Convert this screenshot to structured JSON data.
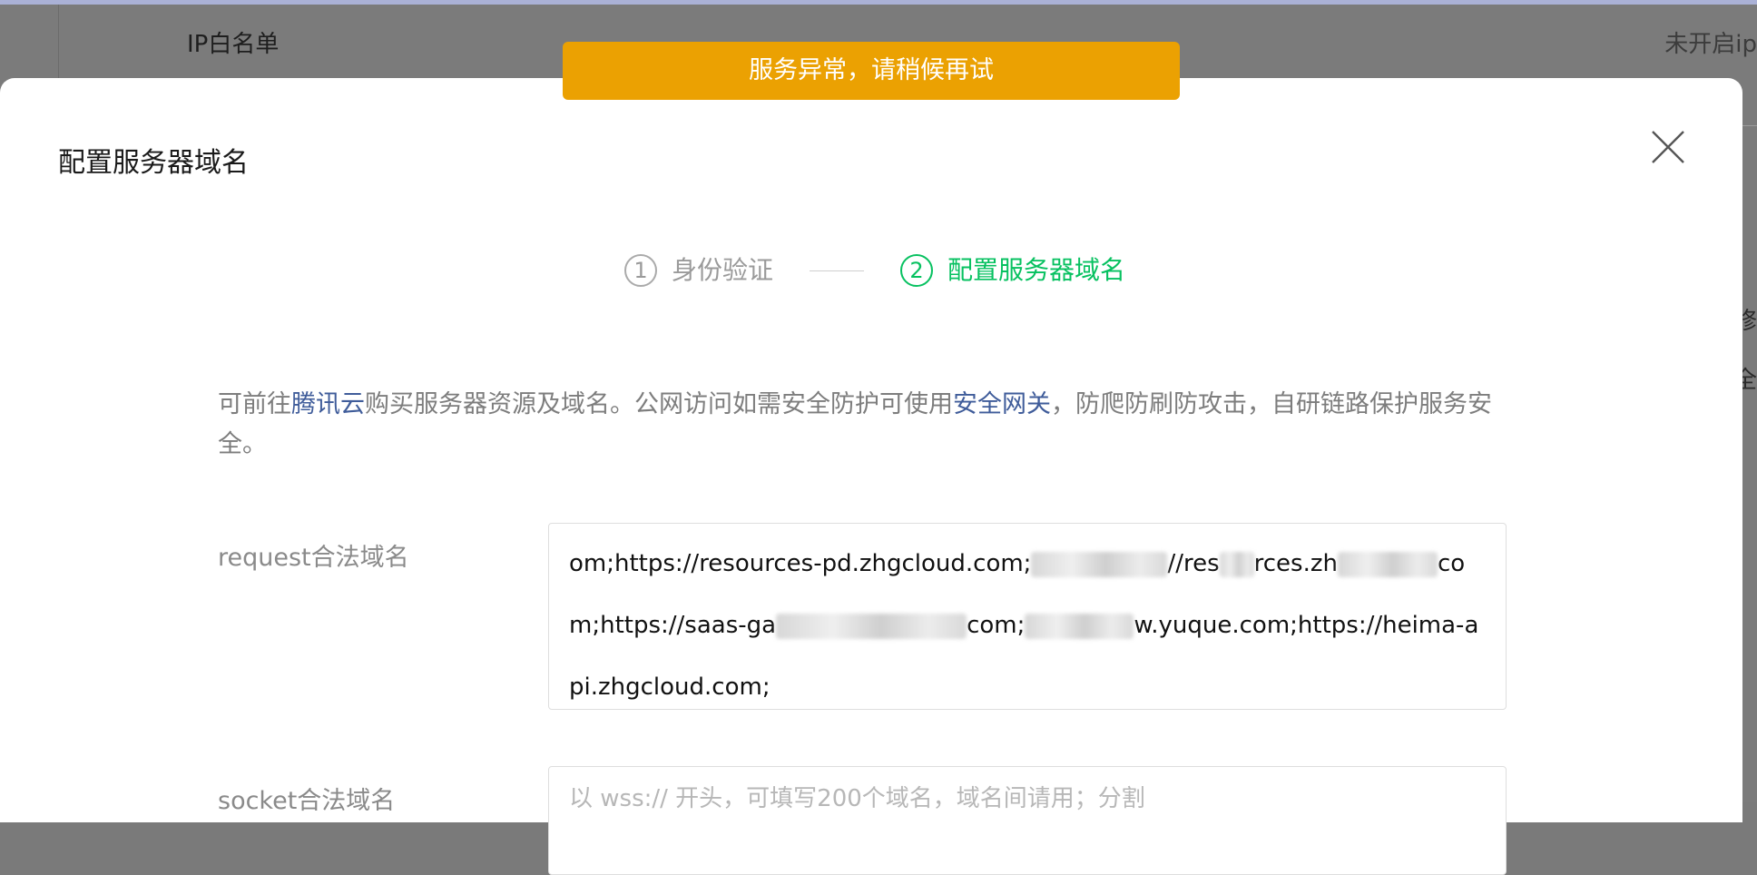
{
  "background": {
    "title": "IP白名单",
    "right_text": "未开启ip",
    "side_char_1": "修",
    "side_char_2": "全"
  },
  "toast": {
    "message": "服务异常，请稍候再试",
    "color": "#eba102"
  },
  "dialog": {
    "title": "配置服务器域名",
    "close_icon": "close-icon"
  },
  "steps": [
    {
      "number": "1",
      "label": "身份验证",
      "state": "done"
    },
    {
      "number": "2",
      "label": "配置服务器域名",
      "state": "active"
    }
  ],
  "intro": {
    "text_1": "可前往",
    "link_1": "腾讯云",
    "text_2": "购买服务器资源及域名。公网访问如需安全防护可使用",
    "link_2": "安全网关",
    "text_3": "，防爬防刷防攻击，自研链路保护服务安全。"
  },
  "fields": {
    "request": {
      "label": "request合法域名",
      "segment_1": "om;https://resources-pd.zhgcloud.com;",
      "segment_2": "//res",
      "segment_3": "rces.zh",
      "segment_4": "com;https://saas-ga",
      "segment_5": "com;",
      "segment_6": "w.yuque.com;",
      "segment_7": "https://heima-api.zhgcloud.com;"
    },
    "socket": {
      "label": "socket合法域名",
      "placeholder": "以 wss:// 开头，可填写200个域名，域名间请用；分割"
    }
  },
  "colors": {
    "accent": "#07c160",
    "link": "#3f5c9a",
    "muted": "#9a9a9a"
  }
}
